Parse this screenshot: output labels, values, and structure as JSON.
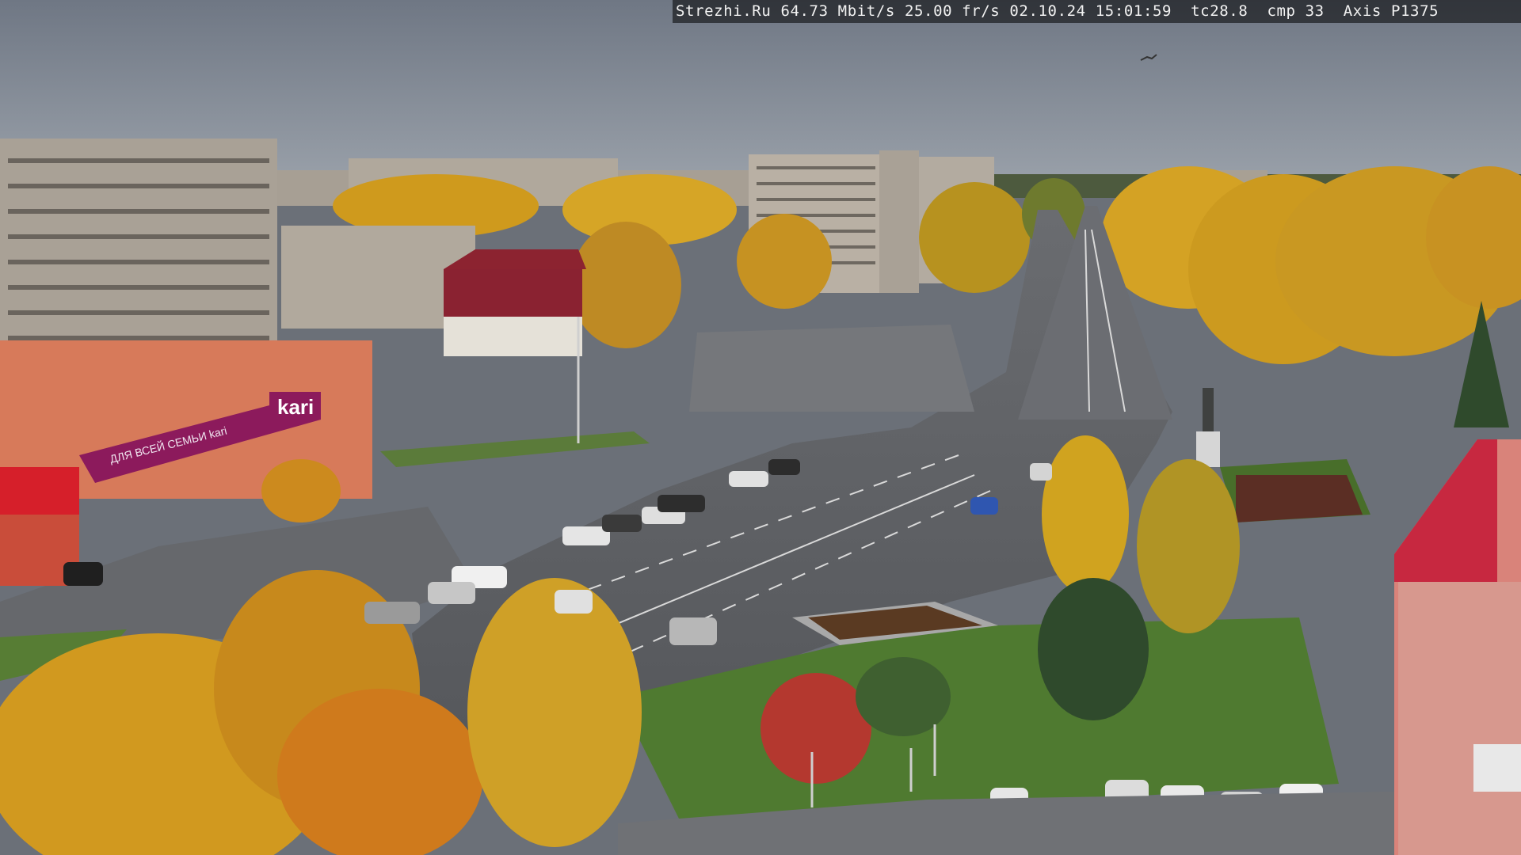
{
  "camera_overlay": {
    "site": "Strezhi.Ru",
    "bitrate": "64.73 Mbit/s",
    "framerate": "25.00 fr/s",
    "date": "02.10.24",
    "time": "15:01:59",
    "tc": "tc28.8",
    "cmp": "cmp 33",
    "device": "Axis P1375"
  },
  "signs": {
    "store_name": "kari",
    "store_banner": "ДЛЯ ВСЕЙ СЕМЬИ kari"
  },
  "colors": {
    "sky": "#7c8591",
    "autumn_foliage": "#d9a21f",
    "asphalt": "#5d5f63",
    "grass": "#4f7a30",
    "kari_banner": "#8c1a5c",
    "red_roof": "#b8283a"
  }
}
